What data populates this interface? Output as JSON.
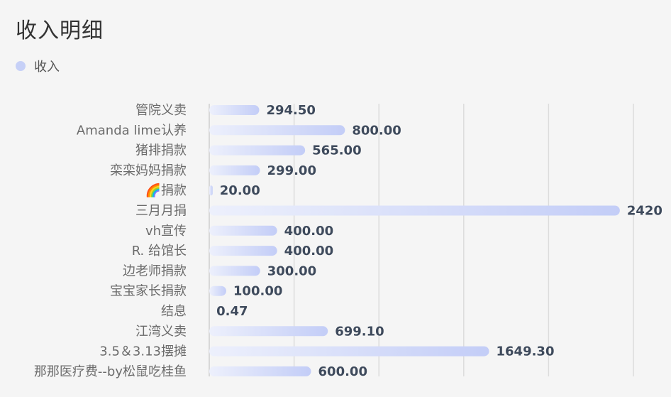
{
  "title": "收入明细",
  "legend": {
    "label": "收入",
    "color": "#c6d0f7"
  },
  "chart_data": {
    "type": "bar",
    "orientation": "horizontal",
    "title": "收入明细",
    "categories": [
      "管院义卖",
      "Amanda lime认养",
      "猪排捐款",
      "栾栾妈妈捐款",
      "🌈捐款",
      "三月月捐",
      "vh宣传",
      "R. 给馆长",
      "边老师捐款",
      "宝宝家长捐款",
      "结息",
      "江湾义卖",
      "3.5＆3.13摆摊",
      "那那医疗费--by松鼠吃桂鱼"
    ],
    "series": [
      {
        "name": "收入",
        "values": [
          294.5,
          800,
          565,
          299,
          20,
          2420,
          400,
          400,
          300,
          100,
          0.47,
          699.1,
          1649.3,
          600
        ],
        "labels": [
          "294.50",
          "800.00",
          "565.00",
          "299.00",
          "20.00",
          "2420",
          "400.00",
          "400.00",
          "300.00",
          "100.00",
          "0.47",
          "699.10",
          "1649.30",
          "600.00"
        ]
      }
    ],
    "xlim": [
      0,
      2500
    ],
    "grid": true,
    "bar_gradient": [
      "#edf0fc",
      "#c3cdf7"
    ]
  }
}
